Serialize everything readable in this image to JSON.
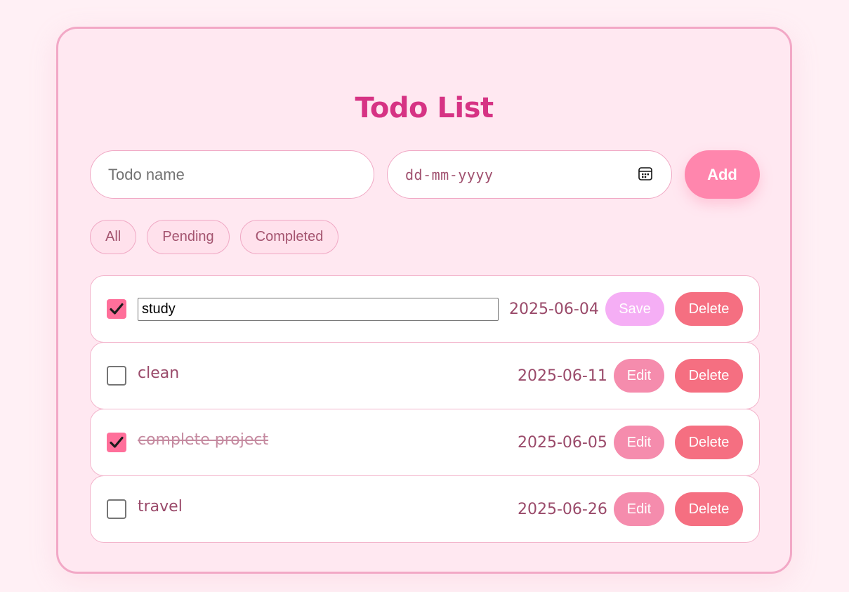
{
  "app": {
    "title": "Todo List"
  },
  "input": {
    "name_placeholder": "Todo name",
    "date_placeholder": "dd-mm-yyyy",
    "add_label": "Add"
  },
  "filters": [
    {
      "label": "All"
    },
    {
      "label": "Pending"
    },
    {
      "label": "Completed"
    }
  ],
  "todos": [
    {
      "name": "study",
      "date": "2025-06-04",
      "completed": true,
      "editing": true,
      "action_label": "Save",
      "delete_label": "Delete"
    },
    {
      "name": "clean",
      "date": "2025-06-11",
      "completed": false,
      "editing": false,
      "action_label": "Edit",
      "delete_label": "Delete"
    },
    {
      "name": "complete project",
      "date": "2025-06-05",
      "completed": true,
      "editing": false,
      "action_label": "Edit",
      "delete_label": "Delete"
    },
    {
      "name": "travel",
      "date": "2025-06-26",
      "completed": false,
      "editing": false,
      "action_label": "Edit",
      "delete_label": "Delete"
    }
  ],
  "icons": {
    "date_picker": "calendar-icon",
    "check": "checkmark-icon"
  },
  "colors": {
    "title": "#d63384",
    "add_button": "#ff86ad",
    "edit_button": "#f58cad",
    "save_button": "#f5aef5",
    "delete_button": "#f56f81",
    "checkbox_checked": "#ff6f9a"
  }
}
